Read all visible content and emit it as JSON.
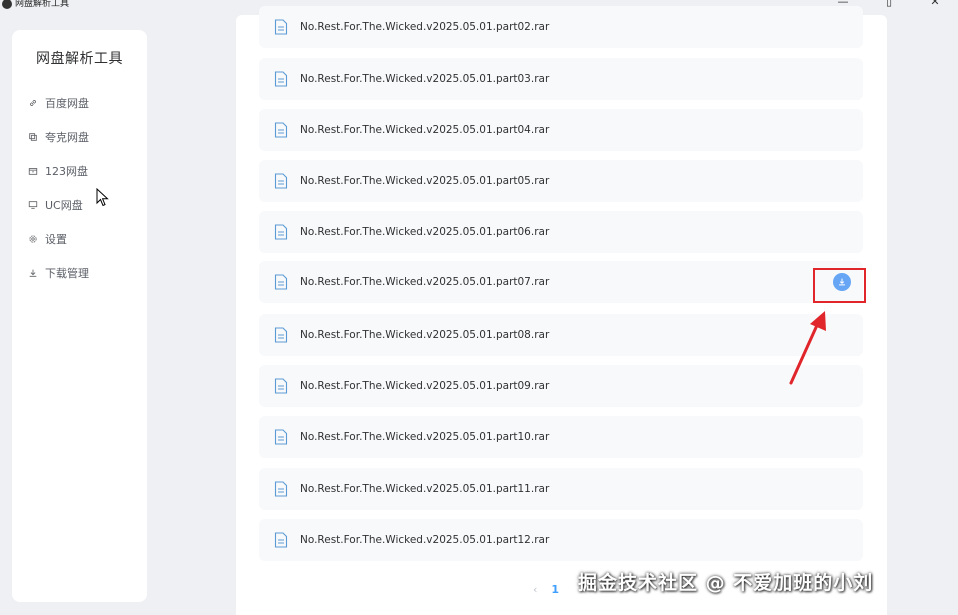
{
  "window": {
    "title": "网盘解析工具",
    "minimize_glyph": "—",
    "maximize_glyph": "▯",
    "close_glyph": "✕"
  },
  "sidebar": {
    "title": "网盘解析工具",
    "items": [
      {
        "label": "百度网盘",
        "icon": "link-icon"
      },
      {
        "label": "夸克网盘",
        "icon": "cube-icon"
      },
      {
        "label": "123网盘",
        "icon": "box-icon"
      },
      {
        "label": "UC网盘",
        "icon": "monitor-icon"
      },
      {
        "label": "设置",
        "icon": "gear-icon"
      },
      {
        "label": "下载管理",
        "icon": "download-icon"
      }
    ]
  },
  "files": [
    {
      "name": "No.Rest.For.The.Wicked.v2025.05.01.part02.rar"
    },
    {
      "name": "No.Rest.For.The.Wicked.v2025.05.01.part03.rar"
    },
    {
      "name": "No.Rest.For.The.Wicked.v2025.05.01.part04.rar"
    },
    {
      "name": "No.Rest.For.The.Wicked.v2025.05.01.part05.rar"
    },
    {
      "name": "No.Rest.For.The.Wicked.v2025.05.01.part06.rar"
    },
    {
      "name": "No.Rest.For.The.Wicked.v2025.05.01.part07.rar"
    },
    {
      "name": "No.Rest.For.The.Wicked.v2025.05.01.part08.rar"
    },
    {
      "name": "No.Rest.For.The.Wicked.v2025.05.01.part09.rar"
    },
    {
      "name": "No.Rest.For.The.Wicked.v2025.05.01.part10.rar"
    },
    {
      "name": "No.Rest.For.The.Wicked.v2025.05.01.part11.rar"
    },
    {
      "name": "No.Rest.For.The.Wicked.v2025.05.01.part12.rar"
    }
  ],
  "pagination": {
    "prev_glyph": "‹",
    "current_page": "1"
  },
  "watermark": "掘金技术社区 @ 不爱加班的小刘",
  "colors": {
    "accent": "#409eff",
    "download_button": "#66a6f5",
    "annotation_red": "#e0252b"
  }
}
